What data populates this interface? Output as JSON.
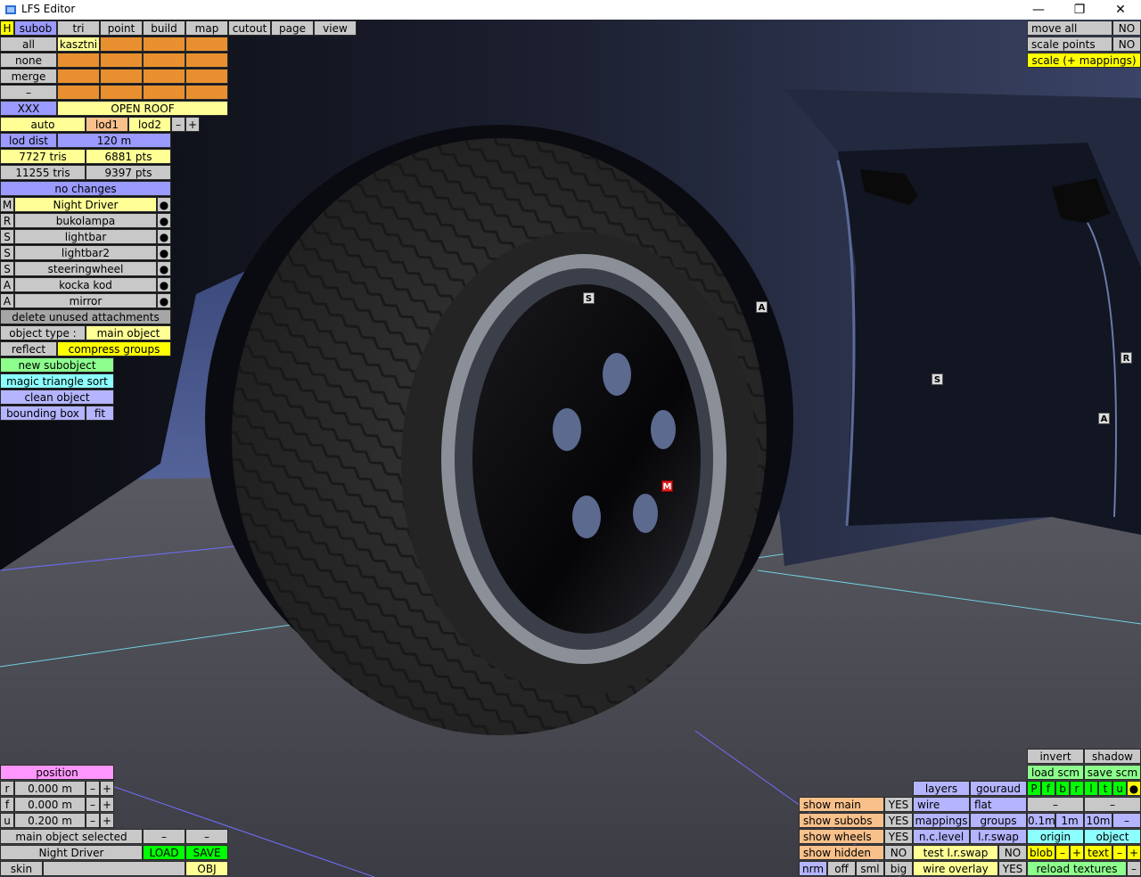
{
  "window": {
    "title": "LFS Editor",
    "controls": [
      "—",
      "❐",
      "✕"
    ]
  },
  "topbar": {
    "h": "H",
    "tabs": [
      "subob",
      "tri",
      "point",
      "build",
      "map",
      "cutout",
      "page",
      "view"
    ]
  },
  "subob": {
    "left_buttons": [
      "all",
      "none",
      "merge",
      "–"
    ],
    "grid_first": "kasztni",
    "xxx": "XXX",
    "open_roof": "OPEN ROOF",
    "auto": "auto",
    "lod1": "lod1",
    "lod2": "lod2",
    "minus": "–",
    "plus": "+",
    "lod_dist_label": "lod dist",
    "lod_dist_value": "120 m",
    "tris1": "7727 tris",
    "pts1": "6881 pts",
    "tris2": "11255 tris",
    "pts2": "9397 pts",
    "no_changes": "no changes",
    "attachments": [
      {
        "type": "M",
        "name": "Night Driver",
        "dot": "●"
      },
      {
        "type": "R",
        "name": "bukolampa",
        "dot": "●"
      },
      {
        "type": "S",
        "name": "lightbar",
        "dot": "●"
      },
      {
        "type": "S",
        "name": "lightbar2",
        "dot": "●"
      },
      {
        "type": "S",
        "name": "steeringwheel",
        "dot": "●"
      },
      {
        "type": "A",
        "name": "kocka kod",
        "dot": "●"
      },
      {
        "type": "A",
        "name": "mirror",
        "dot": "●"
      }
    ],
    "delete_unused": "delete unused attachments",
    "object_type_label": "object type :",
    "object_type_value": "main object",
    "reflect": "reflect",
    "compress_groups": "compress groups",
    "new_subobject": "new subobject",
    "magic_sort": "magic triangle sort",
    "clean_object": "clean object",
    "bounding_box": "bounding box",
    "fit": "fit"
  },
  "top_right": {
    "move_all": "move all",
    "move_all_val": "NO",
    "scale_points": "scale points",
    "scale_points_val": "NO",
    "scale_mappings": "scale (+ mappings)"
  },
  "position": {
    "title": "position",
    "rows": [
      {
        "axis": "r",
        "value": "0.000 m"
      },
      {
        "axis": "f",
        "value": "0.000 m"
      },
      {
        "axis": "u",
        "value": "0.200 m"
      }
    ],
    "minus": "–",
    "plus": "+",
    "selected": "main object selected",
    "dash": "–",
    "name": "Night Driver",
    "load": "LOAD",
    "save": "SAVE",
    "skin": "skin",
    "obj": "OBJ"
  },
  "view_panel": {
    "invert": "invert",
    "shadow": "shadow",
    "load_scm": "load scm",
    "save_scm": "save scm",
    "letters": [
      "P",
      "f",
      "b",
      "r",
      "l",
      "t",
      "u"
    ],
    "dot": "●",
    "layers": "layers",
    "gouraud": "gouraud",
    "show_main": "show main",
    "show_main_val": "YES",
    "wire": "wire",
    "flat": "flat",
    "show_subobs": "show subobs",
    "show_subobs_val": "YES",
    "mappings": "mappings",
    "groups": "groups",
    "show_wheels": "show wheels",
    "show_wheels_val": "YES",
    "nc_level": "n.c.level",
    "lr_swap": "l.r.swap",
    "show_hidden": "show hidden",
    "show_hidden_val": "NO",
    "test_lr_swap": "test l.r.swap",
    "test_lr_swap_val": "NO",
    "dash": "–",
    "plus": "+",
    "step_01": "0.1m",
    "step_1": "1m",
    "step_10": "10m",
    "origin": "origin",
    "object": "object",
    "blob": "blob",
    "text": "text",
    "nrm": "nrm",
    "off": "off",
    "sml": "sml",
    "big": "big",
    "wire_overlay": "wire overlay",
    "wire_overlay_val": "YES",
    "reload_textures": "reload textures"
  },
  "markers": [
    "S",
    "A",
    "R",
    "S",
    "A",
    "M"
  ]
}
